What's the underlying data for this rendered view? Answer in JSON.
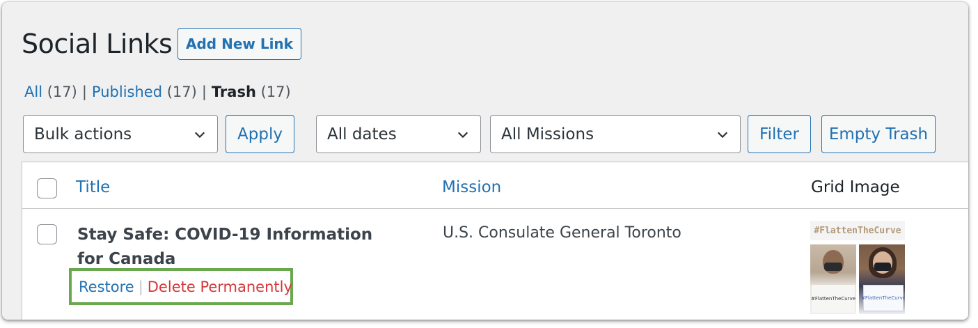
{
  "page": {
    "title": "Social Links",
    "add_new_label": "Add New Link"
  },
  "views": [
    {
      "label": "All",
      "count": "(17)"
    },
    {
      "label": "Published",
      "count": "(17)"
    },
    {
      "label": "Trash",
      "count": "(17)"
    }
  ],
  "view_separator": "|",
  "toolbar": {
    "bulk_actions": "Bulk actions",
    "apply": "Apply",
    "dates": "All dates",
    "missions": "All Missions",
    "filter": "Filter",
    "empty_trash": "Empty Trash"
  },
  "table": {
    "columns": [
      "Title",
      "Mission",
      "Grid Image"
    ],
    "rows": [
      {
        "title": "Stay Safe: COVID-19 Information for Canada",
        "mission": "U.S. Consulate General Toronto",
        "actions": {
          "restore": "Restore",
          "separator": "|",
          "delete": "Delete Permanently"
        },
        "image": {
          "hashtag": "#FlattenTheCurve",
          "sign_left": "#FlattenTheCurve",
          "sign_right": "#FlattenTheCurve"
        }
      }
    ]
  },
  "colors": {
    "link": "#2271b1",
    "delete": "#d63638",
    "highlight": "#6aa84f",
    "background": "#f0f0f1"
  }
}
